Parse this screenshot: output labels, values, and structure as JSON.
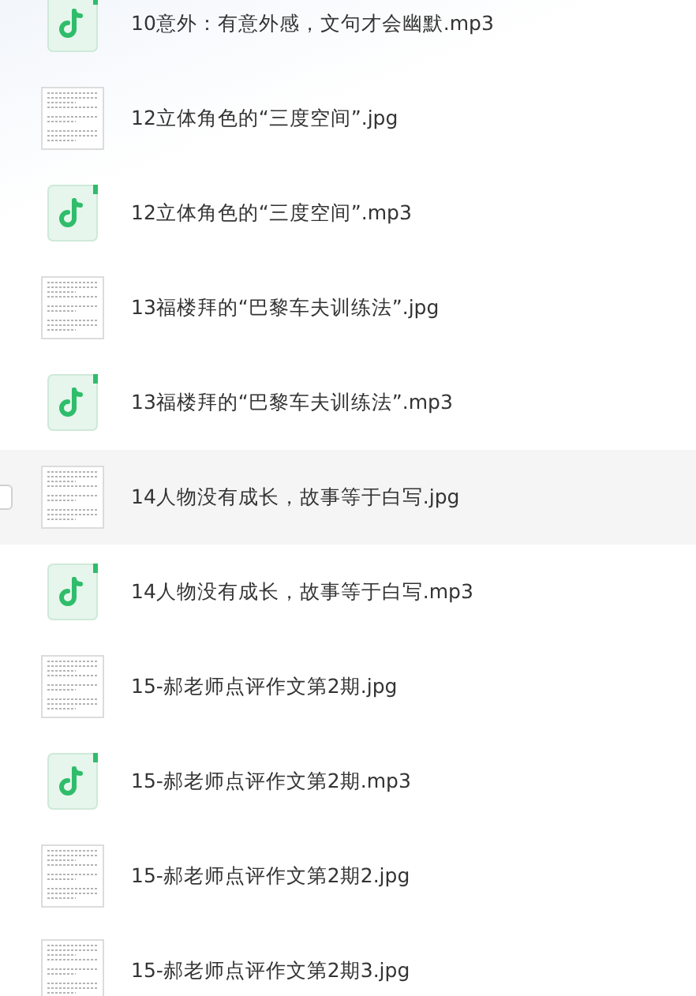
{
  "files": [
    {
      "kind": "audio",
      "name": "10意外：有意外感，文句才会幽默.mp3",
      "hovered": false
    },
    {
      "kind": "image",
      "name": "12立体角色的“三度空间”.jpg",
      "hovered": false
    },
    {
      "kind": "audio",
      "name": "12立体角色的“三度空间”.mp3",
      "hovered": false
    },
    {
      "kind": "image",
      "name": "13福楼拜的“巴黎车夫训练法”.jpg",
      "hovered": false
    },
    {
      "kind": "audio",
      "name": "13福楼拜的“巴黎车夫训练法”.mp3",
      "hovered": false
    },
    {
      "kind": "image",
      "name": "14人物没有成长，故事等于白写.jpg",
      "hovered": true
    },
    {
      "kind": "audio",
      "name": "14人物没有成长，故事等于白写.mp3",
      "hovered": false
    },
    {
      "kind": "image",
      "name": "15-郝老师点评作文第2期.jpg",
      "hovered": false
    },
    {
      "kind": "audio",
      "name": "15-郝老师点评作文第2期.mp3",
      "hovered": false
    },
    {
      "kind": "image",
      "name": "15-郝老师点评作文第2期2.jpg",
      "hovered": false
    },
    {
      "kind": "image",
      "name": "15-郝老师点评作文第2期3.jpg",
      "hovered": false
    }
  ]
}
